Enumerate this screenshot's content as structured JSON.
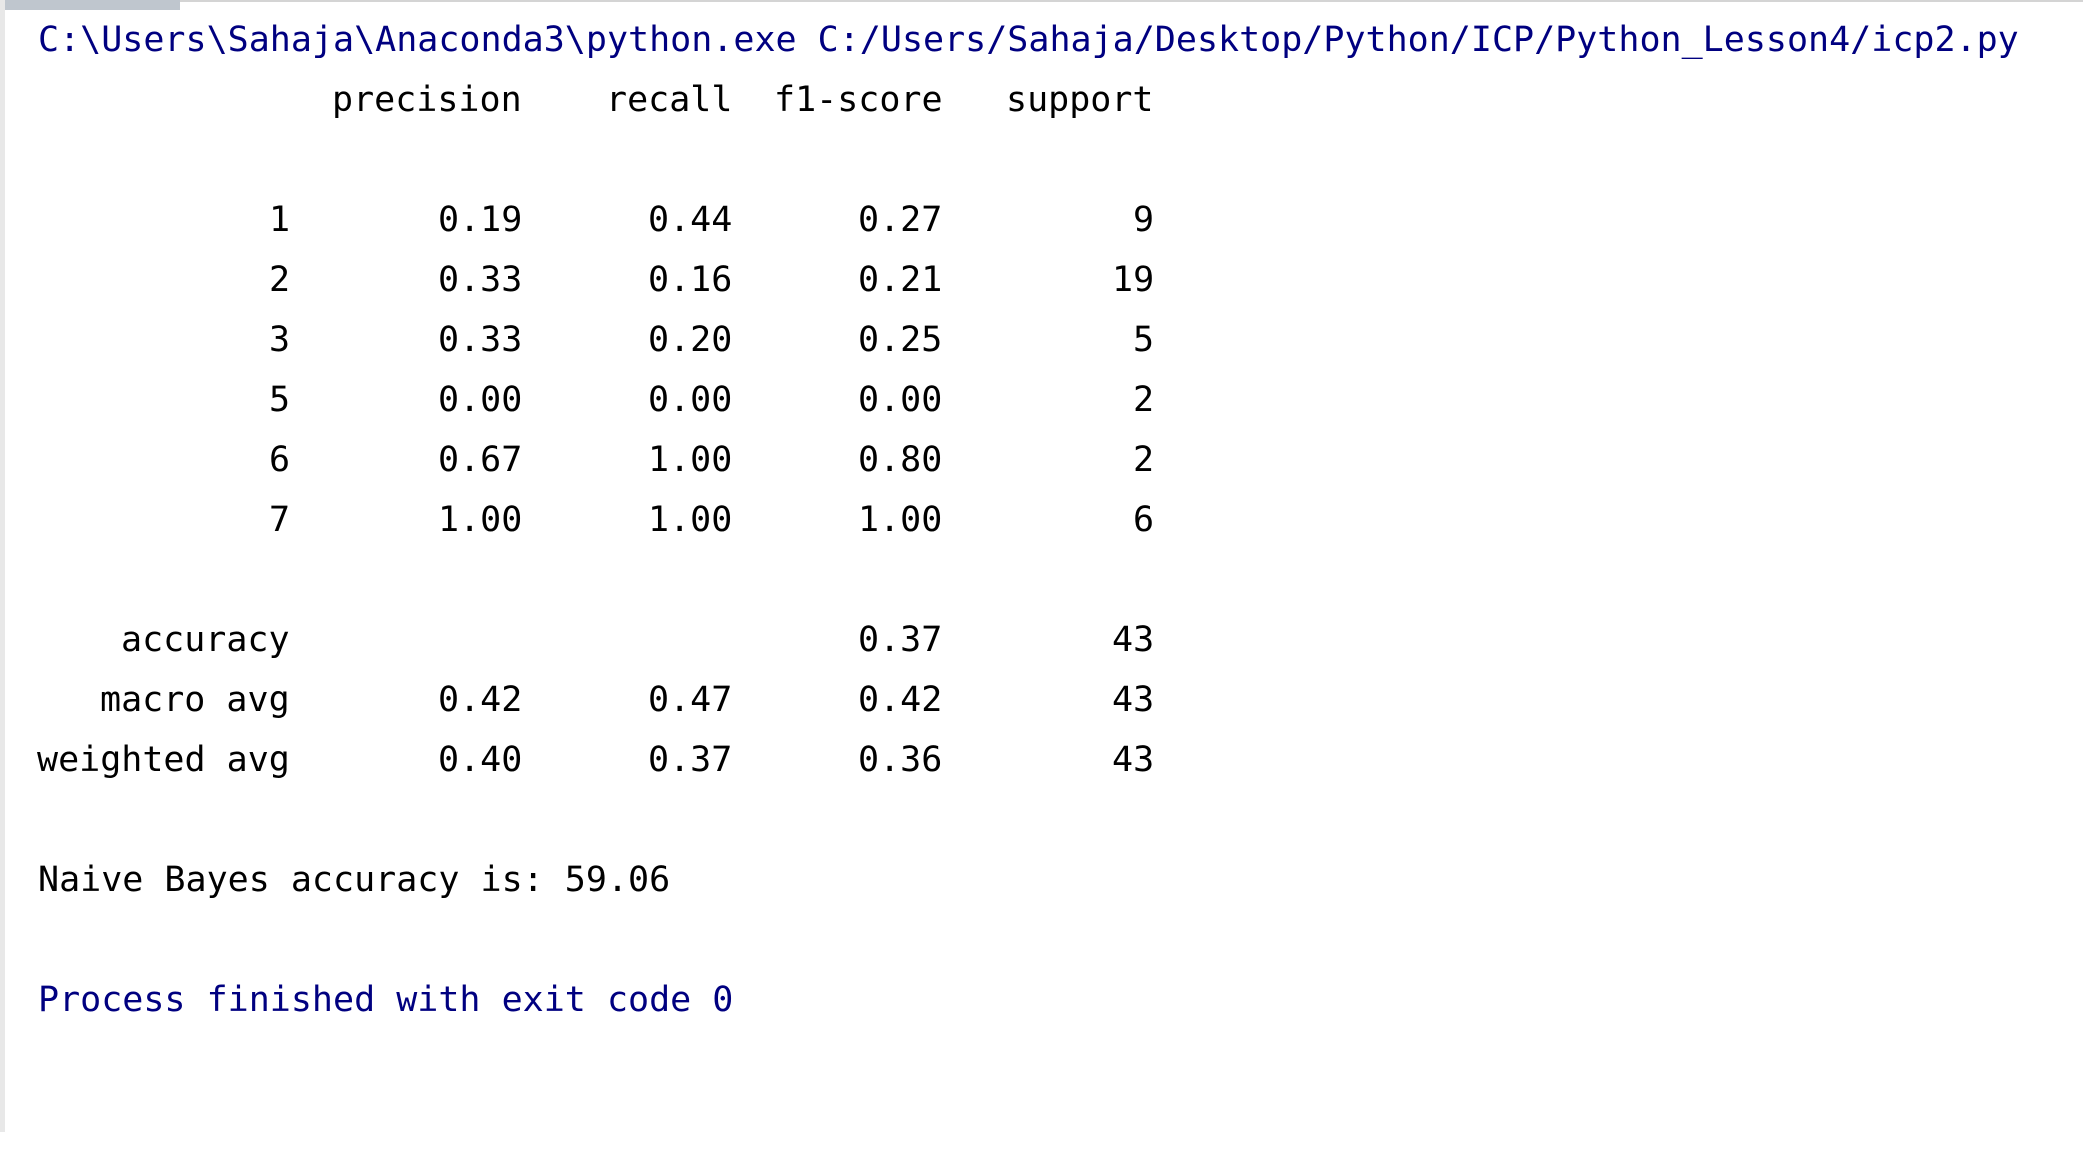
{
  "console": {
    "command": "C:\\Users\\Sahaja\\Anaconda3\\python.exe C:/Users/Sahaja/Desktop/Python/ICP/Python_Lesson4/icp2.py",
    "headers": {
      "precision": "precision",
      "recall": "recall",
      "f1": "f1-score",
      "support": "support"
    },
    "rows": [
      {
        "label": "1",
        "precision": "0.19",
        "recall": "0.44",
        "f1": "0.27",
        "support": "9"
      },
      {
        "label": "2",
        "precision": "0.33",
        "recall": "0.16",
        "f1": "0.21",
        "support": "19"
      },
      {
        "label": "3",
        "precision": "0.33",
        "recall": "0.20",
        "f1": "0.25",
        "support": "5"
      },
      {
        "label": "5",
        "precision": "0.00",
        "recall": "0.00",
        "f1": "0.00",
        "support": "2"
      },
      {
        "label": "6",
        "precision": "0.67",
        "recall": "1.00",
        "f1": "0.80",
        "support": "2"
      },
      {
        "label": "7",
        "precision": "1.00",
        "recall": "1.00",
        "f1": "1.00",
        "support": "6"
      }
    ],
    "summary": [
      {
        "label": "accuracy",
        "precision": "",
        "recall": "",
        "f1": "0.37",
        "support": "43"
      },
      {
        "label": "macro avg",
        "precision": "0.42",
        "recall": "0.47",
        "f1": "0.42",
        "support": "43"
      },
      {
        "label": "weighted avg",
        "precision": "0.40",
        "recall": "0.37",
        "f1": "0.36",
        "support": "43"
      }
    ],
    "result": "Naive Bayes accuracy is: 59.06",
    "exit": "Process finished with exit code 0"
  },
  "colors": {
    "command_text": "#000080",
    "output_text": "#000000",
    "background": "#ffffff"
  }
}
